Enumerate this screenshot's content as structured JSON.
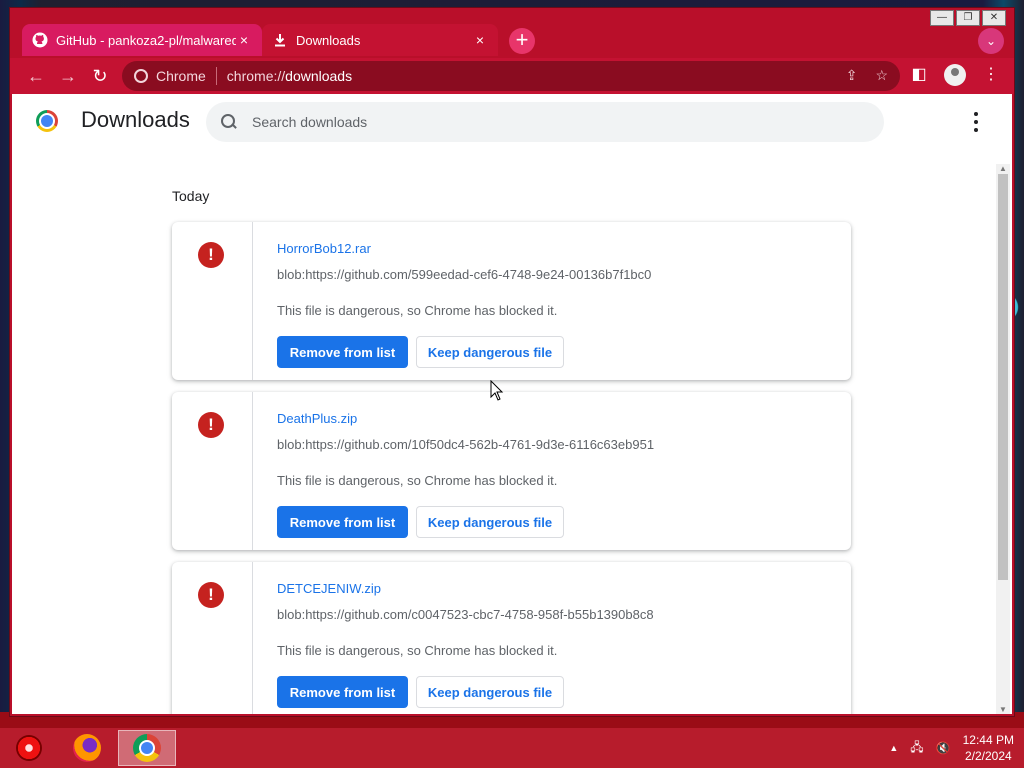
{
  "window": {
    "controls": [
      "—",
      "❐",
      "✕"
    ]
  },
  "tabs": [
    {
      "title": "GitHub - pankoza2-pl/malwared...",
      "icon": "github-icon",
      "close": "×"
    },
    {
      "title": "Downloads",
      "icon": "download-icon",
      "close": "×"
    }
  ],
  "toolbar": {
    "new_tab": "+",
    "tab_search": "⌄",
    "back": "←",
    "forward": "→",
    "reload": "↻",
    "site_chip": "Chrome",
    "url_prefix": "chrome://",
    "url_host": "downloads",
    "share_icon": "⇪",
    "bookmark_icon": "☆",
    "sidepanel_icon": "◧",
    "menu_icon": "⋮"
  },
  "page": {
    "title": "Downloads",
    "search_placeholder": "Search downloads",
    "date_group": "Today"
  },
  "downloads": [
    {
      "name": "HorrorBob12.rar",
      "url": "blob:https://github.com/599eedad-cef6-4748-9e24-00136b7f1bc0",
      "status": "This file is dangerous, so Chrome has blocked it.",
      "primary_action": "Remove from list",
      "secondary_action": "Keep dangerous file",
      "warn_glyph": "!"
    },
    {
      "name": "DeathPlus.zip",
      "url": "blob:https://github.com/10f50dc4-562b-4761-9d3e-6116c63eb951",
      "status": "This file is dangerous, so Chrome has blocked it.",
      "primary_action": "Remove from list",
      "secondary_action": "Keep dangerous file",
      "warn_glyph": "!"
    },
    {
      "name": "DETCEJENIW.zip",
      "url": "blob:https://github.com/c0047523-cbc7-4758-958f-b55b1390b8c8",
      "status": "This file is dangerous, so Chrome has blocked it.",
      "primary_action": "Remove from list",
      "secondary_action": "Keep dangerous file",
      "warn_glyph": "!"
    }
  ],
  "taskbar": {
    "apps": [
      "start-icon",
      "firefox-icon",
      "chrome-icon"
    ],
    "tray_arrow": "▲",
    "network_icon": "🖧",
    "volume_icon": "🔇",
    "time": "12:44 PM",
    "date": "2/2/2024"
  },
  "colors": {
    "accent": "#1a73e8",
    "danger": "#c5221f",
    "theme": "#c41232"
  }
}
